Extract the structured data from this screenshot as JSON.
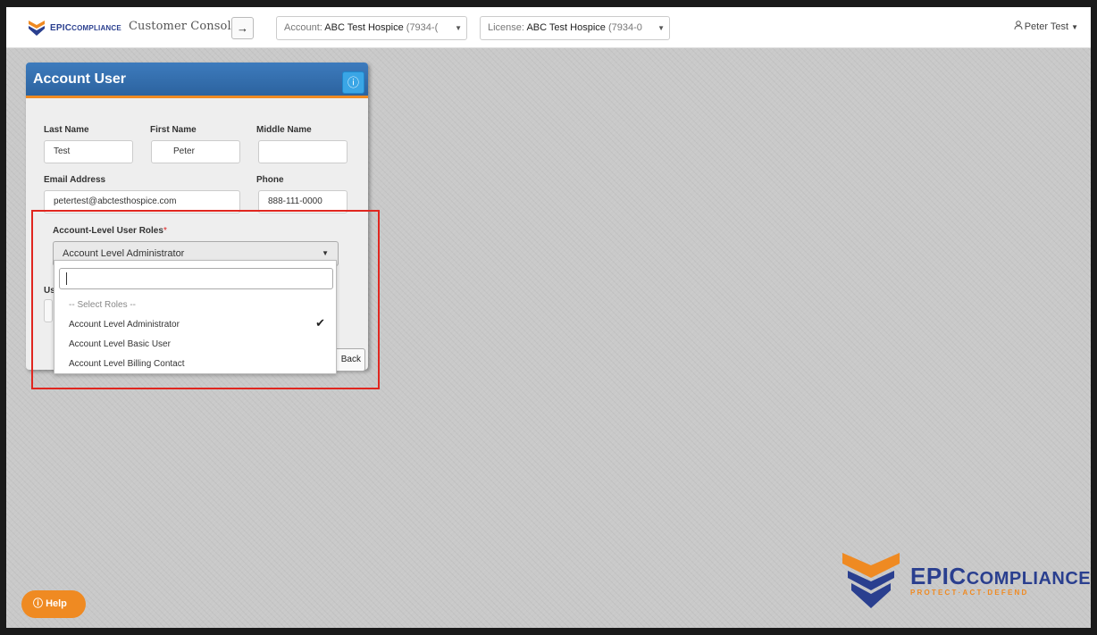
{
  "header": {
    "brand_prefix": "EPIC",
    "brand_suffix": "OMPLIANCE",
    "console_title": "Customer Console",
    "go_icon": "→",
    "account_selector": {
      "prefix": "Account:",
      "value": "ABC Test Hospice",
      "suffix": "(7934-("
    },
    "license_selector": {
      "prefix": "License:",
      "value": "ABC Test Hospice",
      "suffix": "(7934-0"
    },
    "user_name": "Peter Test"
  },
  "panel": {
    "title": "Account User",
    "info_icon": "info-icon",
    "labels": {
      "last_name": "Last Name",
      "first_name": "First Name",
      "middle_name": "Middle Name",
      "email": "Email Address",
      "phone": "Phone",
      "roles": "Account-Level User Roles",
      "roles_required": "*",
      "partial_label": "Us"
    },
    "values": {
      "last_name": "Test",
      "first_name": "Peter",
      "middle_name": "",
      "email": "petertest@abctesthospice.com",
      "phone": "888-111-0000"
    },
    "roles_selected": "Account Level Administrator",
    "back_label": "Back"
  },
  "dropdown": {
    "search_value": "",
    "options": [
      {
        "label": "-- Select Roles --",
        "selected": false
      },
      {
        "label": "Account Level Administrator",
        "selected": true
      },
      {
        "label": "Account Level Basic User",
        "selected": false
      },
      {
        "label": "Account Level Billing Contact",
        "selected": false
      }
    ],
    "check_glyph": "✔"
  },
  "help_label": "Help",
  "footer": {
    "brand_prefix": "EPIC",
    "brand_suffix": "OMPLIANCE",
    "tagline": "PROTECT·ACT·DEFEND"
  },
  "colors": {
    "accent_orange": "#ef8a22",
    "header_blue": "#2c639f",
    "brand_navy": "#2a3f8f",
    "highlight_red": "#e0261f"
  }
}
